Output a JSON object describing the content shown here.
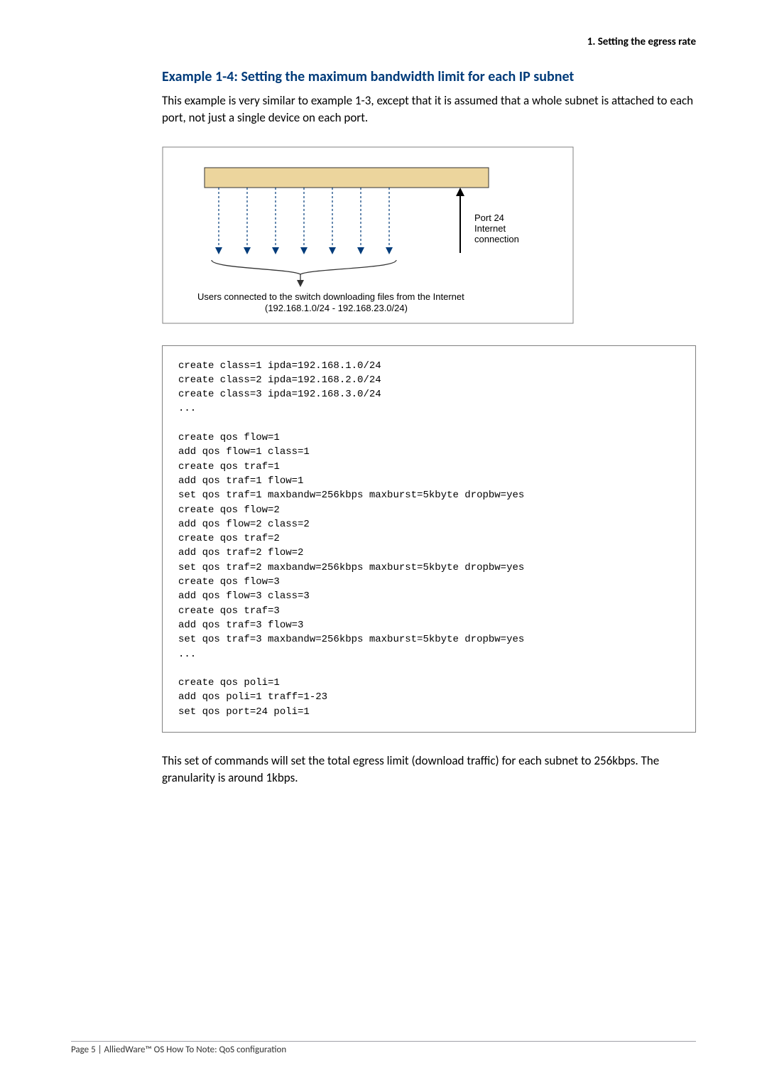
{
  "header": {
    "section": "1. Setting the egress rate"
  },
  "title": "Example 1-4: Setting the maximum bandwidth limit for each IP subnet",
  "intro": "This example is very similar to example 1-3, except that it is assumed that a whole subnet is attached to each port, not just a single device on each port.",
  "diagram": {
    "port_label_line1": "Port 24",
    "port_label_line2": "Internet",
    "port_label_line3": "connection",
    "caption_line1": "Users connected to the switch downloading files from the Internet",
    "caption_line2": "(192.168.1.0/24 - 192.168.23.0/24)"
  },
  "code": "create class=1 ipda=192.168.1.0/24\ncreate class=2 ipda=192.168.2.0/24\ncreate class=3 ipda=192.168.3.0/24\n...\n\ncreate qos flow=1\nadd qos flow=1 class=1\ncreate qos traf=1\nadd qos traf=1 flow=1\nset qos traf=1 maxbandw=256kbps maxburst=5kbyte dropbw=yes\ncreate qos flow=2\nadd qos flow=2 class=2\ncreate qos traf=2\nadd qos traf=2 flow=2\nset qos traf=2 maxbandw=256kbps maxburst=5kbyte dropbw=yes\ncreate qos flow=3\nadd qos flow=3 class=3\ncreate qos traf=3\nadd qos traf=3 flow=3\nset qos traf=3 maxbandw=256kbps maxburst=5kbyte dropbw=yes\n...\n\ncreate qos poli=1\nadd qos poli=1 traff=1-23\nset qos port=24 poli=1",
  "outro": "This set of commands will set the total egress limit (download traffic) for each subnet to 256kbps. The granularity is around 1kbps.",
  "footer": "Page 5 | AlliedWare™ OS How To Note: QoS configuration"
}
